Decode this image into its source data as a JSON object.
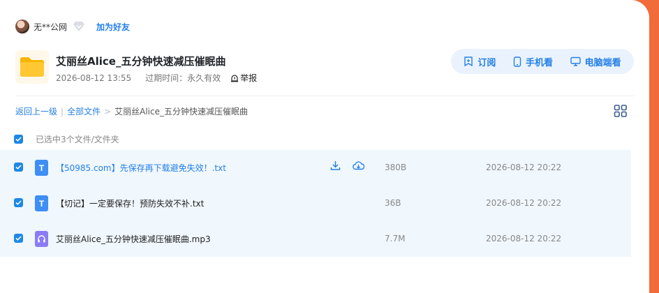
{
  "user": {
    "name": "无**公网",
    "add_friend": "加为好友"
  },
  "share": {
    "title": "艾丽丝Alice_五分钟快速减压催眠曲",
    "date": "2026-08-12 13:55",
    "expire_label": "过期时间：",
    "expire_value": "永久有效",
    "report": "举报"
  },
  "actions": {
    "subscribe": "订阅",
    "mobile": "手机看",
    "desktop": "电脑端看"
  },
  "breadcrumb": {
    "back": "返回上一级",
    "all_files": "全部文件",
    "current": "艾丽丝Alice_五分钟快速减压催眠曲"
  },
  "selection": {
    "text": "已选中3个文件/文件夹"
  },
  "files": [
    {
      "type_letter": "T",
      "name": "【50985.com】先保存再下载避免失效！.txt",
      "size": "380B",
      "date": "2026-08-12 20:22"
    },
    {
      "type_letter": "T",
      "name": "【切记】一定要保存！预防失效不补.txt",
      "size": "36B",
      "date": "2026-08-12 20:22"
    },
    {
      "type_letter": "",
      "name": "艾丽丝Alice_五分钟快速减压催眠曲.mp3",
      "size": "7.7M",
      "date": "2026-08-12 20:22"
    }
  ],
  "icons": [
    "vip-diamond-icon",
    "folder-icon",
    "report-icon",
    "subscribe-icon",
    "phone-icon",
    "monitor-icon",
    "grid-view-icon",
    "download-icon",
    "cloud-save-icon",
    "audio-file-icon",
    "text-file-icon"
  ],
  "colors": {
    "accent": "#2580e6",
    "row_bg": "#f0f7fd",
    "page_bg": "#f26b3a",
    "checkbox": "#1e88e5"
  }
}
